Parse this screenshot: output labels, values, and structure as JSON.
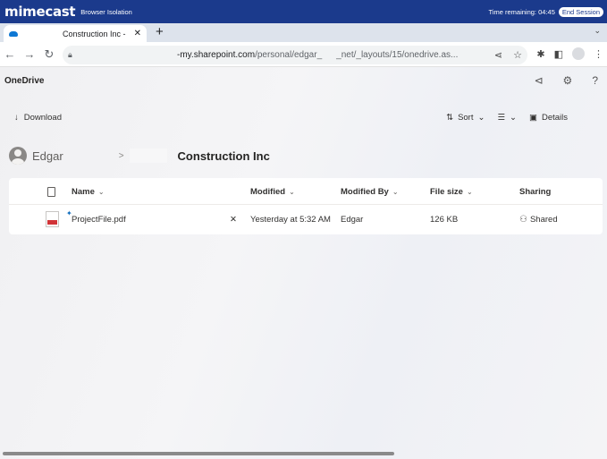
{
  "mimecast": {
    "logo": "mimecast",
    "subtitle": "Browser Isolation",
    "time_remaining": "Time remaining: 04:45",
    "end_session": "End Session"
  },
  "browser": {
    "tab_title": "Construction Inc -",
    "tab_close": "✕",
    "new_tab": "+",
    "url_host": "-my.sharepoint.com",
    "url_path_a": "/personal/edgar_",
    "url_path_b": "_net/_layouts/15/onedrive.as..."
  },
  "app": {
    "title": "OneDrive"
  },
  "commands": {
    "download": "Download",
    "sort": "Sort",
    "details": "Details"
  },
  "breadcrumb": {
    "user": "Edgar",
    "separator": ">",
    "current": "Construction Inc"
  },
  "file_list": {
    "columns": [
      "Name",
      "Modified",
      "Modified By",
      "File size",
      "Sharing"
    ],
    "rows": [
      {
        "name": "ProjectFile.pdf",
        "modified": "Yesterday at 5:32 AM",
        "modified_by": "Edgar",
        "file_size": "126 KB",
        "sharing": "Shared"
      }
    ]
  },
  "colors": {
    "mimecast_bar": "#1b3a8c",
    "onedrive_blue": "#0f78d4",
    "pdf_red": "#d13438"
  }
}
